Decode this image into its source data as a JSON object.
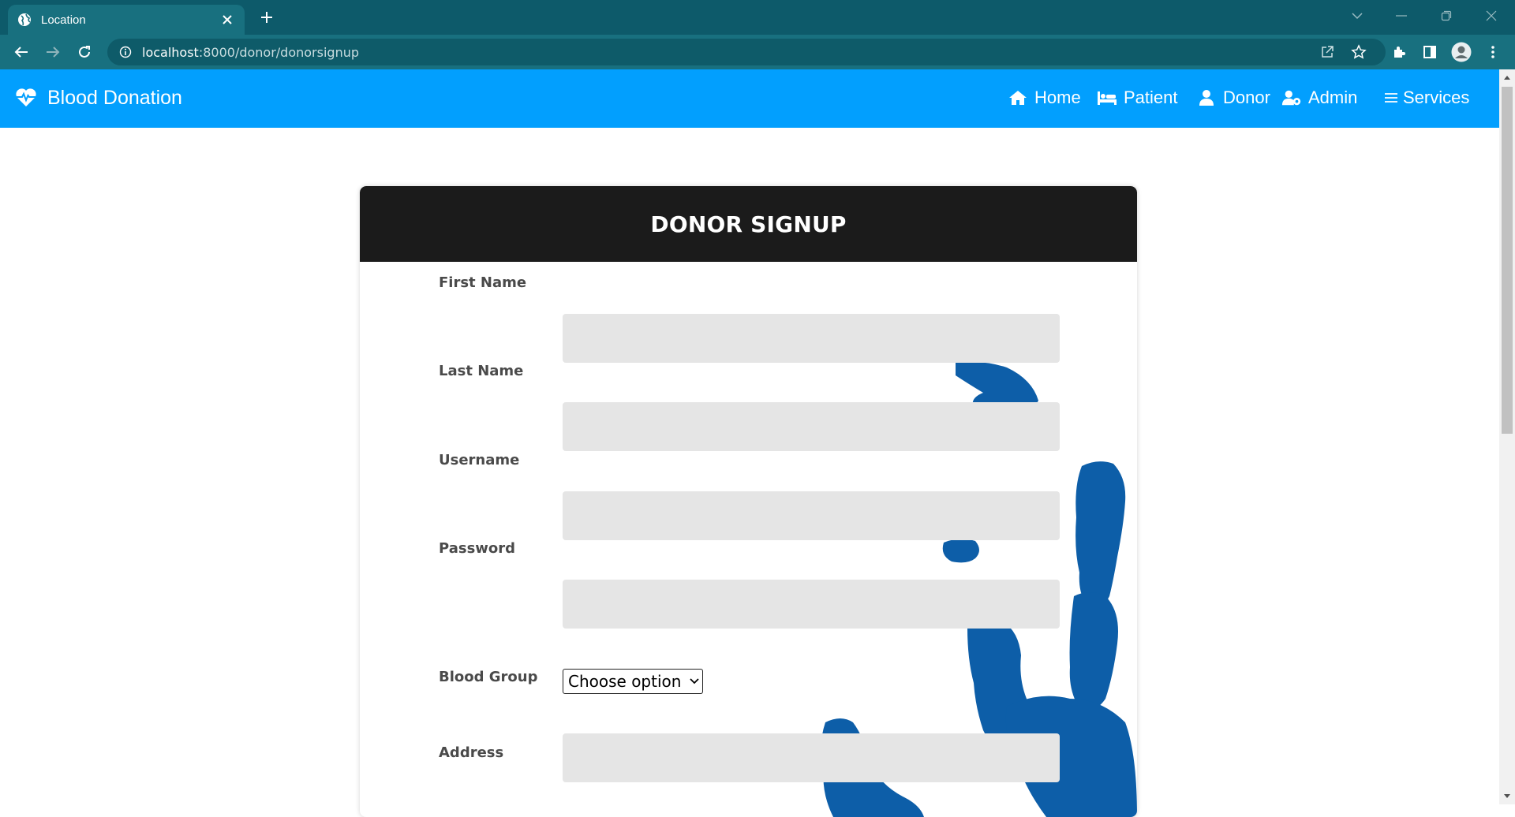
{
  "browser": {
    "tab_title": "Location",
    "url_host": "localhost",
    "url_rest": ":8000/donor/donorsignup"
  },
  "site": {
    "brand": "Blood Donation",
    "nav": {
      "home": "Home",
      "patient": "Patient",
      "donor": "Donor",
      "admin": "Admin",
      "services": "Services"
    },
    "accent_color": "#029ffe"
  },
  "form": {
    "title": "DONOR SIGNUP",
    "fields": {
      "first_name": {
        "label": "First Name",
        "value": ""
      },
      "last_name": {
        "label": "Last Name",
        "value": ""
      },
      "username": {
        "label": "Username",
        "value": ""
      },
      "password": {
        "label": "Password",
        "value": ""
      },
      "blood_group": {
        "label": "Blood Group",
        "selected": "Choose option"
      },
      "address": {
        "label": "Address",
        "value": ""
      }
    }
  }
}
